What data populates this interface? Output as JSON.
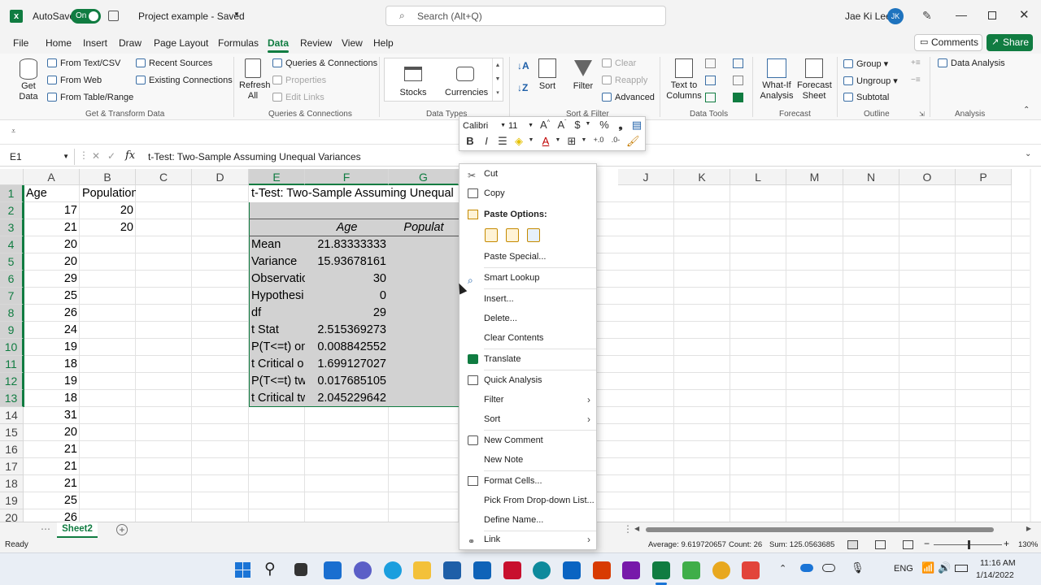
{
  "titlebar": {
    "autosave_label": "AutoSave",
    "autosave_state": "On",
    "doc_title": "Project example - Saved",
    "search_placeholder": "Search (Alt+Q)",
    "user_name": "Jae Ki Lee",
    "user_initials": "JK"
  },
  "menu_tabs": [
    "File",
    "Home",
    "Insert",
    "Draw",
    "Page Layout",
    "Formulas",
    "Data",
    "Review",
    "View",
    "Help"
  ],
  "header_buttons": {
    "comments": "Comments",
    "share": "Share"
  },
  "ribbon": {
    "get_data": "Get Data",
    "from_text_csv": "From Text/CSV",
    "from_web": "From Web",
    "from_table_range": "From Table/Range",
    "recent_sources": "Recent Sources",
    "existing_connections": "Existing Connections",
    "group_get_transform": "Get & Transform Data",
    "refresh_all": "Refresh All",
    "queries_connections": "Queries & Connections",
    "properties": "Properties",
    "edit_links": "Edit Links",
    "group_queries": "Queries & Connections",
    "stocks": "Stocks",
    "currencies": "Currencies",
    "group_data_types": "Data Types",
    "sort": "Sort",
    "filter": "Filter",
    "clear": "Clear",
    "reapply": "Reapply",
    "advanced": "Advanced",
    "group_sort_filter": "Sort & Filter",
    "text_to_columns": "Text to Columns",
    "group_data_tools": "Data Tools",
    "what_if": "What-If Analysis",
    "forecast_sheet": "Forecast Sheet",
    "group_forecast": "Forecast",
    "group": "Group",
    "ungroup": "Ungroup",
    "subtotal": "Subtotal",
    "group_outline": "Outline",
    "data_analysis": "Data Analysis",
    "group_analysis": "Analysis"
  },
  "formula_bar": {
    "name_box": "E1",
    "fx": "fx",
    "formula": "t-Test: Two-Sample Assuming Unequal Variances"
  },
  "columns": [
    "A",
    "B",
    "C",
    "D",
    "E",
    "F",
    "G",
    "J",
    "K",
    "L",
    "M",
    "N",
    "O",
    "P"
  ],
  "rows": [
    "1",
    "2",
    "3",
    "4",
    "5",
    "6",
    "7",
    "8",
    "9",
    "10",
    "11",
    "12",
    "13",
    "14",
    "15",
    "16",
    "17",
    "18",
    "19",
    "20"
  ],
  "col_a": [
    "Age",
    "17",
    "21",
    "20",
    "20",
    "29",
    "25",
    "26",
    "24",
    "19",
    "18",
    "19",
    "18",
    "31",
    "20",
    "21",
    "21",
    "21",
    "25",
    "26"
  ],
  "col_b": [
    "Population",
    "20",
    "20"
  ],
  "col_e": [
    "t-Test: Two-Sample Assuming Unequal",
    "",
    "",
    "Mean",
    "Variance",
    "Observatio",
    "Hypothesi",
    "df",
    "t Stat",
    "P(T<=t) on",
    "t Critical o",
    "P(T<=t) tw",
    "t Critical tw"
  ],
  "col_f": [
    "",
    "",
    "Age",
    "21.83333333",
    "15.93678161",
    "30",
    "0",
    "29",
    "2.515369273",
    "0.008842552",
    "1.699127027",
    "0.017685105",
    "2.045229642"
  ],
  "col_g_header": "Populat",
  "mini_toolbar": {
    "font": "Calibri",
    "size": "11"
  },
  "context_menu": {
    "cut": "Cut",
    "copy": "Copy",
    "paste_options": "Paste Options:",
    "paste_special": "Paste Special...",
    "smart_lookup": "Smart Lookup",
    "insert": "Insert...",
    "delete": "Delete...",
    "clear_contents": "Clear Contents",
    "translate": "Translate",
    "quick_analysis": "Quick Analysis",
    "filter": "Filter",
    "sort": "Sort",
    "new_comment": "New Comment",
    "new_note": "New Note",
    "format_cells": "Format Cells...",
    "pick_dropdown": "Pick From Drop-down List...",
    "define_name": "Define Name...",
    "link": "Link"
  },
  "sheet_tab": "Sheet2",
  "status": {
    "ready": "Ready",
    "average": "Average: 9.619720657",
    "count": "Count: 26",
    "sum": "Sum: 125.0563685",
    "zoom": "130%"
  },
  "taskbar": {
    "lang": "ENG",
    "time": "11:16 AM",
    "date": "1/14/2022"
  },
  "colors": {
    "excel_green": "#107c41",
    "selection_gray": "#d2d2d2"
  }
}
